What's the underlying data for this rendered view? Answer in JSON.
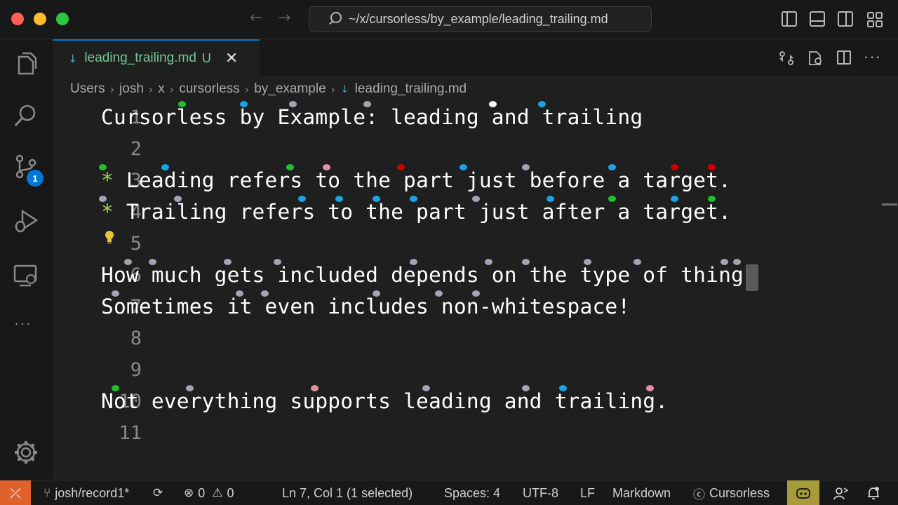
{
  "titlebar": {
    "back_arrow": "←",
    "forward_arrow": "→",
    "command_center_text": "~/x/cursorless/by_example/leading_trailing.md"
  },
  "activity_bar": {
    "source_control_badge": "1",
    "more": "···"
  },
  "tab": {
    "icon": "↓",
    "filename": "leading_trailing.md",
    "status": "U",
    "close": "✕"
  },
  "breadcrumb": {
    "items": [
      "Users",
      "josh",
      "x",
      "cursorless",
      "by_example"
    ],
    "separator": "›",
    "file_icon": "↓",
    "file": "leading_trailing.md"
  },
  "editor": {
    "lines": [
      {
        "num": "1",
        "text": "Cursorless by Example: leading and trailing"
      },
      {
        "num": "2",
        "text": ""
      },
      {
        "num": "3",
        "bullet": "*",
        "text": " Leading refers to the part just before a target."
      },
      {
        "num": "4",
        "bullet": "*",
        "text": " Trailing refers to the part just after a target."
      },
      {
        "num": "5",
        "text": ""
      },
      {
        "num": "6",
        "text": "How much gets included depends on the type of thing."
      },
      {
        "num": "7",
        "text": "Sometimes it even includes non-whitespace!"
      },
      {
        "num": "8",
        "text": ""
      },
      {
        "num": "9",
        "text": ""
      },
      {
        "num": "10",
        "text": "Not everything supports leading and trailing."
      },
      {
        "num": "11",
        "text": ""
      }
    ],
    "hat_colors": {
      "default": "#a3a3b8",
      "blue": "#1aa3e8",
      "green": "#22c02a",
      "red": "#d10000",
      "pink": "#e68fa0",
      "white": "#ffffff"
    }
  },
  "statusbar": {
    "remote_icon": "⤫",
    "branch_icon": "⑂",
    "branch": "josh/record1*",
    "sync_icon": "⟳",
    "errors_icon": "⊗",
    "errors": "0",
    "warnings_icon": "⚠",
    "warnings": "0",
    "position": "Ln 7, Col 1 (1 selected)",
    "spaces": "Spaces: 4",
    "encoding": "UTF-8",
    "eol": "LF",
    "language": "Markdown",
    "cursorless_icon": "ⓒ",
    "cursorless": "Cursorless"
  }
}
